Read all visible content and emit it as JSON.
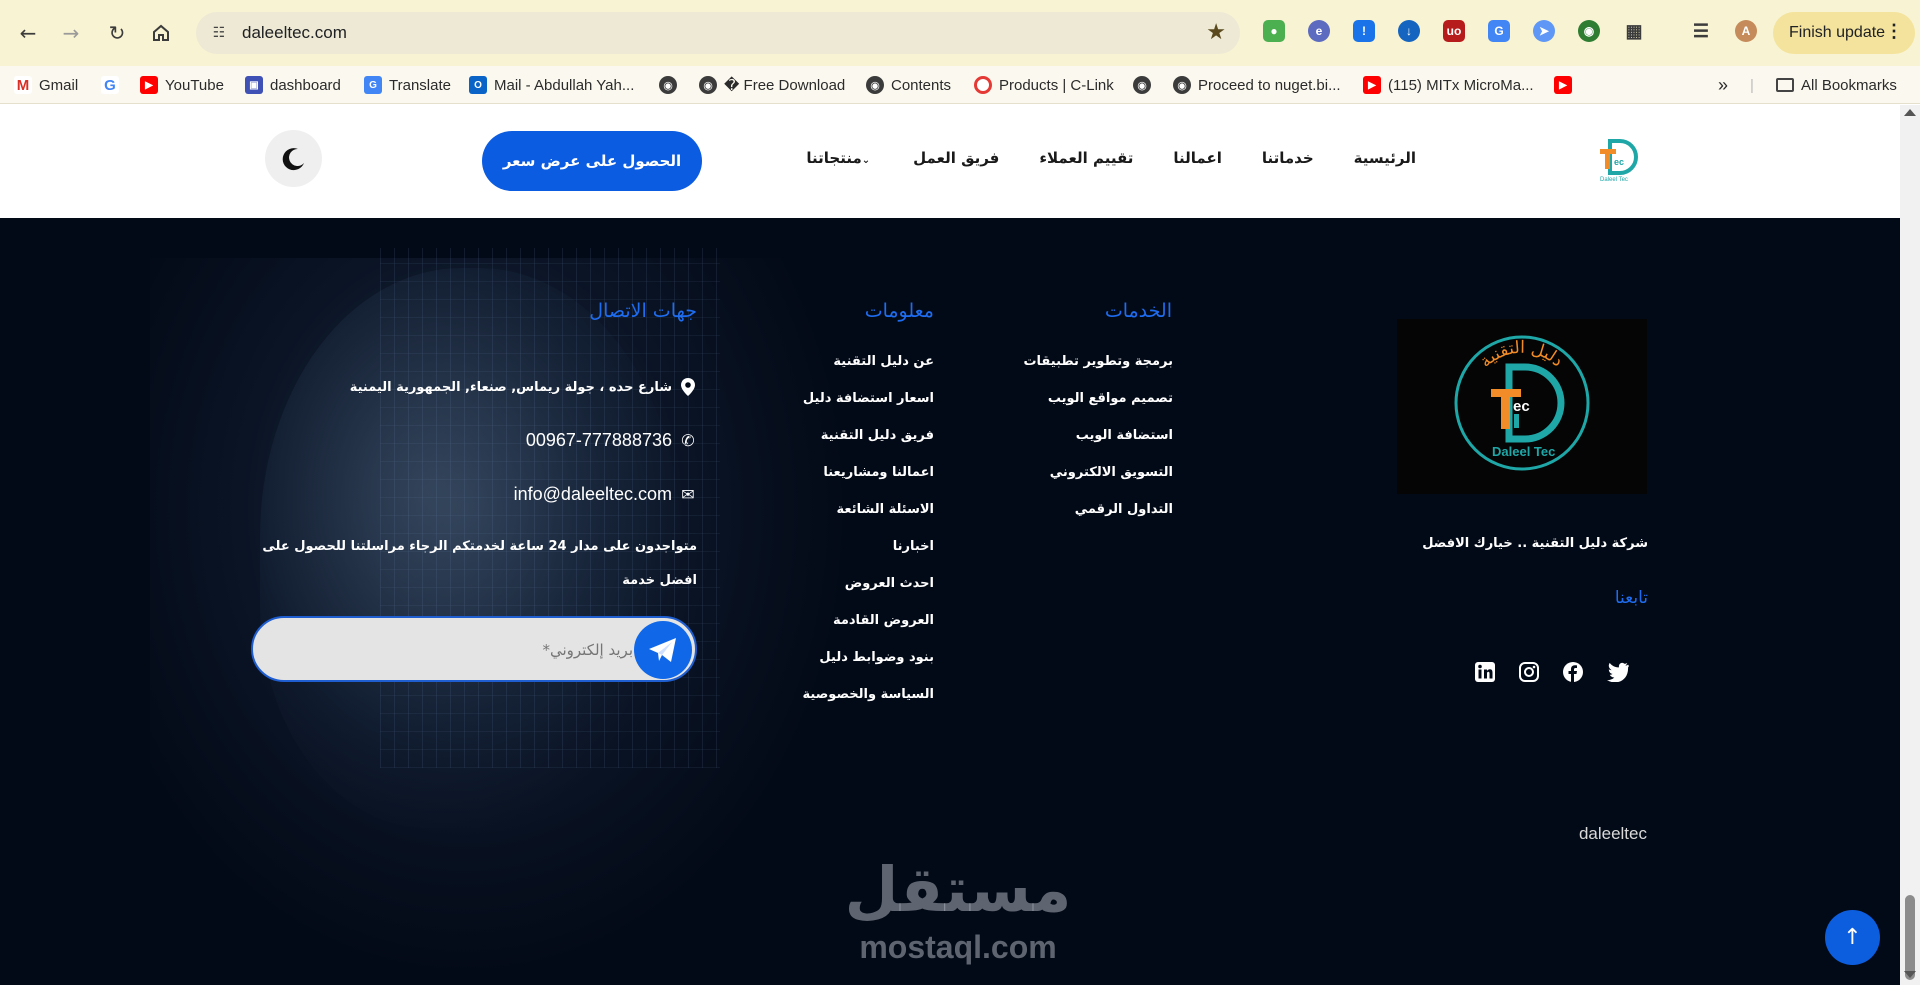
{
  "browser": {
    "url": "daleeltec.com",
    "finish_update_label": "Finish update",
    "bookmarks": [
      {
        "label": "Gmail",
        "icon": "gmail-icon"
      },
      {
        "label": "",
        "icon": "google-icon"
      },
      {
        "label": "YouTube",
        "icon": "youtube-icon"
      },
      {
        "label": "dashboard",
        "icon": "dashboard-icon"
      },
      {
        "label": "Translate",
        "icon": "translate-icon"
      },
      {
        "label": "Mail - Abdullah Yah...",
        "icon": "outlook-icon"
      },
      {
        "label": "",
        "icon": "globe-icon"
      },
      {
        "label": "� Free Download",
        "icon": "globe-icon"
      },
      {
        "label": "Contents",
        "icon": "globe-icon"
      },
      {
        "label": "Products | C-Link",
        "icon": "clink-icon"
      },
      {
        "label": "",
        "icon": "globe-icon"
      },
      {
        "label": "Proceed to nuget.bi...",
        "icon": "globe-icon"
      },
      {
        "label": "(115) MITx MicroMa...",
        "icon": "youtube-icon"
      },
      {
        "label": "",
        "icon": "youtube-icon"
      }
    ],
    "all_bookmarks_label": "All Bookmarks"
  },
  "header": {
    "menu": [
      "الرئيسية",
      "خدماتنا",
      "اعمالنا",
      "تقييم العملاء",
      "فريق العمل",
      "منتجاتنا"
    ],
    "quote_button": "الحصول على عرض سعر",
    "theme_icon": "moon-icon"
  },
  "footer": {
    "services_title": "الخدمات",
    "services": [
      "برمجة وتطوير تطبيقات",
      "تصميم مواقع الويب",
      "استضافة الويب",
      "التسويق الالكتروني",
      "التداول الرقمي"
    ],
    "info_title": "معلومات",
    "info": [
      "عن دليل التقنية",
      "اسعار استضافة دليل",
      "فريق دليل التقنية",
      "اعمالنا ومشاريعنا",
      "الاسئلة الشائعة",
      "اخبارنا",
      "احدث العروض",
      "العروض القادمة",
      "بنود وضوابط دليل",
      "السياسة والخصوصية"
    ],
    "contact_title": "جهات الاتصال",
    "address": "شارع حده ، جولة ريماس, صنعاء, الجمهورية اليمنية",
    "phone": "00967-777888736",
    "email": "info@daleeltec.com",
    "availability": "متواجدون على مدار 24 ساعة لخدمتكم الرجاء مراسلتنا للحصول على افضل خدمة",
    "email_placeholder": "بريد إلكتروني*",
    "logo_arc_text": "دليل التقنية",
    "logo_caption": "Daleel Tec",
    "logo_mark": "Tec",
    "tagline": "شركة دليل التقنية .. خيارك الافضل",
    "follow_title": "تابعنا",
    "social": [
      "twitter-icon",
      "facebook-icon",
      "instagram-icon",
      "linkedin-icon"
    ],
    "brand": "daleeltec",
    "watermark_ar": "مستقل",
    "watermark_en": "mostaql.com"
  },
  "colors": {
    "accent": "#0b5ce0",
    "footer_bg": "#030a17",
    "title_blue": "#1e6cf0",
    "logo_teal": "#1fa7a8",
    "logo_orange": "#f28c28"
  }
}
